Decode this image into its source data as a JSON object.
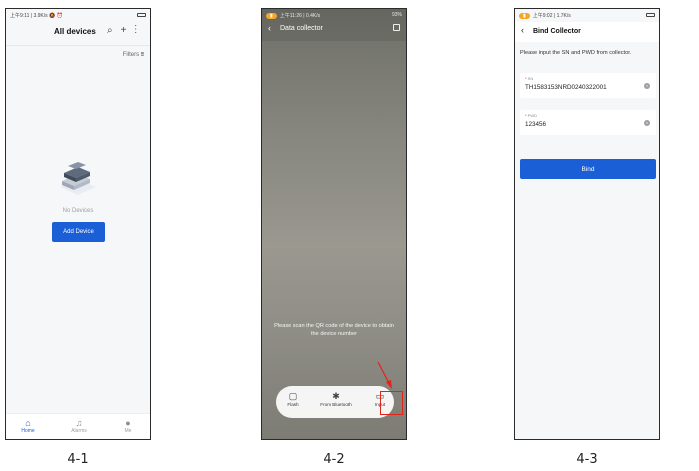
{
  "phone1": {
    "status_left": "上午9:11 | 3.9K/s 🔕 ⏰",
    "title": "All devices",
    "icons": [
      "search-icon",
      "plus-icon",
      "more-vertical-icon"
    ],
    "filters_label": "Filters",
    "empty_text": "No Devices",
    "add_device_label": "Add Device",
    "tabs": [
      {
        "label": "Home",
        "icon": "home-icon",
        "active": true
      },
      {
        "label": "Alarms",
        "icon": "bell-icon",
        "active": false
      },
      {
        "label": "Me",
        "icon": "person-icon",
        "active": false
      }
    ],
    "accent_color": "#1a5fd6"
  },
  "phone2": {
    "status_left": "上午11:26 | 0.4K/s",
    "status_right": "93%",
    "title": "Data collector",
    "hint": "Please scan the QR code of the device to obtain the device number",
    "toolbar": [
      {
        "label": "Flash",
        "icon": "flashlight-icon"
      },
      {
        "label": "From Bluetooth",
        "icon": "bluetooth-icon"
      },
      {
        "label": "Input",
        "icon": "keypad-icon"
      }
    ],
    "highlight_color": "#e2231a"
  },
  "phone3": {
    "status_left": "上午9:02 | 1.7K/s",
    "title": "Bind Collector",
    "prompt": "Please input the SN and PWD from collector.",
    "sn_label": "SN",
    "sn_value": "TH1583153NRD0240322001",
    "pwd_label": "PWD",
    "pwd_value": "123456",
    "bind_label": "Bind"
  },
  "captions": [
    "4-1",
    "4-2",
    "4-3"
  ]
}
